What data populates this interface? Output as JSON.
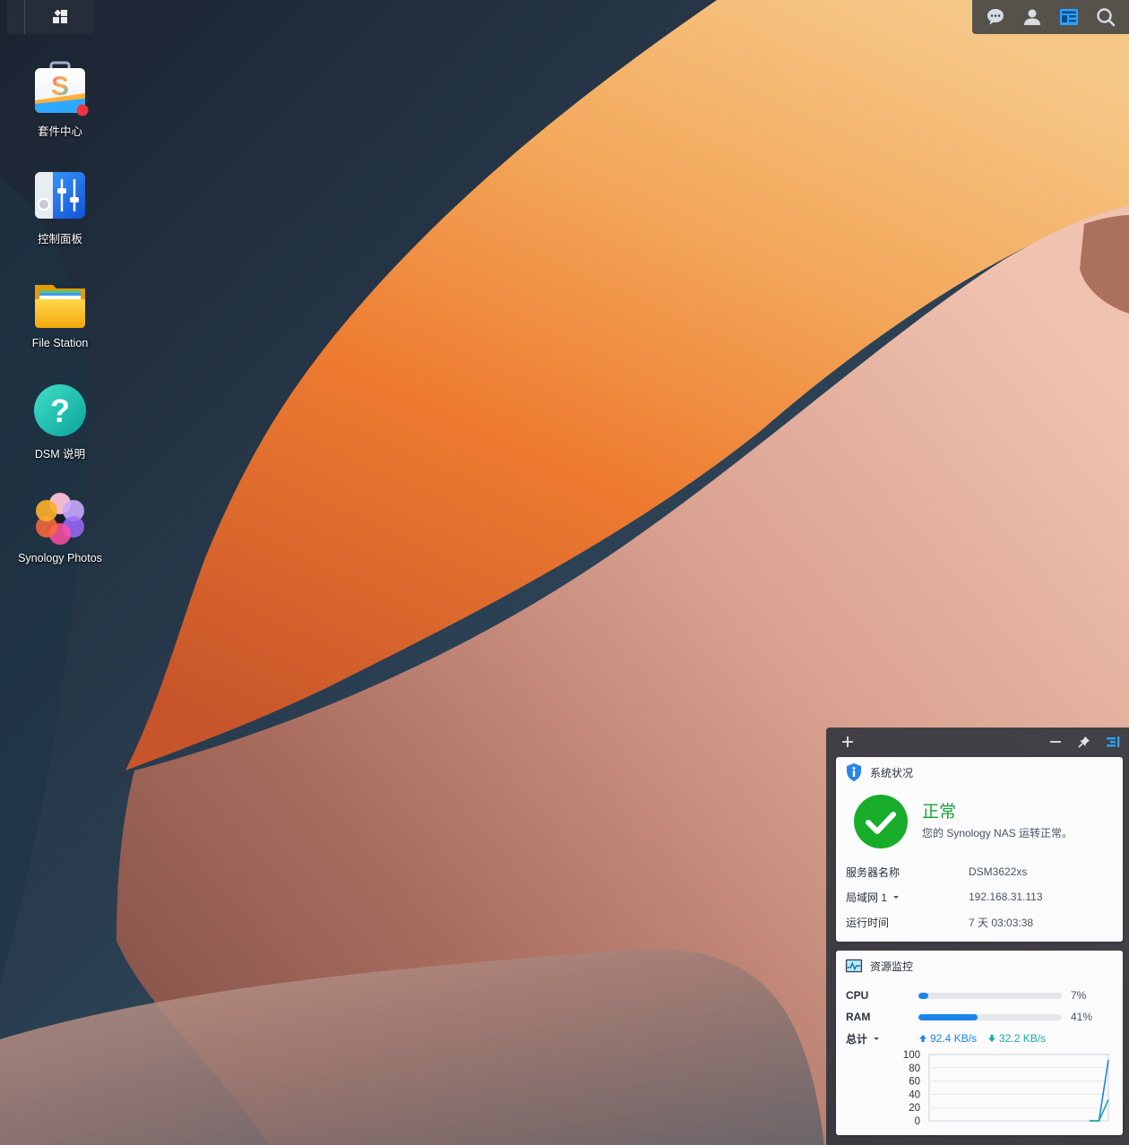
{
  "desktop": {
    "icons": [
      {
        "label": "套件中心",
        "icon": "package-center-icon",
        "has_notification": true
      },
      {
        "label": "控制面板",
        "icon": "control-panel-icon"
      },
      {
        "label": "File Station",
        "icon": "file-station-icon"
      },
      {
        "label": "DSM 说明",
        "icon": "dsm-help-icon"
      },
      {
        "label": "Synology Photos",
        "icon": "synology-photos-icon"
      }
    ]
  },
  "taskbar": {
    "left": [
      "main-menu-icon"
    ],
    "right": [
      "notifications-icon",
      "user-icon",
      "widgets-icon",
      "search-icon"
    ]
  },
  "widgets": {
    "system_status": {
      "title": "系统状况",
      "status": "正常",
      "description": "您的 Synology NAS 运转正常。",
      "rows": [
        {
          "key": "服务器名称",
          "value": "DSM3622xs"
        },
        {
          "key": "局域网 1",
          "value": "192.168.31.113",
          "has_dropdown": true
        },
        {
          "key": "运行时间",
          "value": "7 天 03:03:38"
        }
      ]
    },
    "resource_monitor": {
      "title": "资源监控",
      "cpu": {
        "label": "CPU",
        "percent": 7,
        "display": "7%"
      },
      "ram": {
        "label": "RAM",
        "percent": 41,
        "display": "41%"
      },
      "network": {
        "label": "总计",
        "upload": "92.4 KB/s",
        "download": "32.2 KB/s"
      },
      "colors": {
        "upload": "#1a85e8",
        "download": "#17a9a0"
      }
    }
  },
  "chart_data": {
    "type": "line",
    "ylim": [
      0,
      100
    ],
    "yticks": [
      "100",
      "80",
      "60",
      "40",
      "20",
      "0"
    ],
    "x": [
      0,
      1,
      2,
      3,
      4,
      5,
      6,
      7,
      8,
      9,
      10,
      11,
      12,
      13,
      14,
      15,
      16,
      17,
      18,
      19
    ],
    "series": [
      {
        "values": [
          null,
          null,
          null,
          null,
          null,
          null,
          null,
          null,
          null,
          null,
          null,
          null,
          null,
          null,
          null,
          null,
          null,
          0,
          0,
          92
        ],
        "color": "#1a85e8"
      },
      {
        "values": [
          null,
          null,
          null,
          null,
          null,
          null,
          null,
          null,
          null,
          null,
          null,
          null,
          null,
          null,
          null,
          null,
          null,
          0,
          0,
          32
        ],
        "color": "#17a9a0"
      }
    ],
    "grid": true
  }
}
